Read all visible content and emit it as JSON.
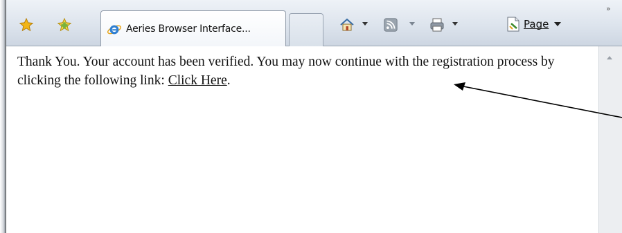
{
  "browser": {
    "tab": {
      "title": "Aeries Browser Interface..."
    },
    "command_bar": {
      "page_label": "Page",
      "overflow": "»"
    },
    "icons": {
      "favorites": "favorites-star-icon",
      "add_favorites": "add-favorites-icon",
      "tab_page": "ie-logo-icon",
      "home": "home-icon",
      "feeds": "rss-feed-icon",
      "print": "print-icon",
      "page": "page-icon"
    },
    "colors": {
      "toolbar_top": "#eef2f7",
      "toolbar_bottom": "#cdd6e2",
      "favorites_star": "#f2b517",
      "add_favorites_star": "#7ab23d",
      "ie_logo": "#2f7fd1",
      "rss": "#7e8a96"
    }
  },
  "page": {
    "message_part1": "Thank You. Your account has been verified. You may now continue with the registration process by clicking the following link: ",
    "link_label": "Click Here",
    "message_end": "."
  }
}
